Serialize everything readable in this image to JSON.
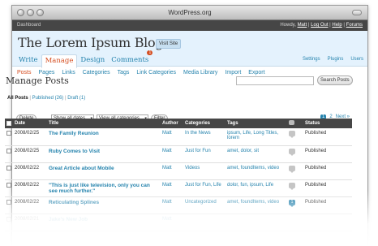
{
  "window": {
    "title": "WordPress.org"
  },
  "admin_bar": {
    "left": "Dashboard",
    "howdy": "Howdy,",
    "user": "Matt",
    "links": [
      "Log Out",
      "Help",
      "Forums"
    ]
  },
  "header": {
    "blog_title": "The Lorem Ipsum Blog",
    "visit_site": "Visit Site"
  },
  "main_nav": {
    "tabs": [
      {
        "label": "Write"
      },
      {
        "label": "Manage"
      },
      {
        "label": "Design"
      },
      {
        "label": "Comments",
        "badge": "1"
      }
    ],
    "right": [
      "Settings",
      "Plugins",
      "Users"
    ]
  },
  "sub_nav": [
    "Posts",
    "Pages",
    "Links",
    "Categories",
    "Tags",
    "Link Categories",
    "Media Library",
    "Import",
    "Export"
  ],
  "page": {
    "title": "Manage Posts",
    "search_button": "Search Posts",
    "search_value": ""
  },
  "status_filter": {
    "all": "All Posts",
    "published": "Published (26)",
    "draft": "Draft (1)"
  },
  "filters": {
    "delete": "Delete",
    "dates": "Show all dates",
    "categories": "View all categories",
    "filter": "Filter",
    "pages": [
      "1",
      "2"
    ],
    "next": "Next »"
  },
  "table": {
    "headers": {
      "date": "Date",
      "title": "Title",
      "author": "Author",
      "categories": "Categories",
      "tags": "Tags",
      "status": "Status"
    },
    "rows": [
      {
        "date": "2008/02/25",
        "title": "The Family Reunion",
        "author": "Matt",
        "categories": "In the News",
        "tags": "ipsum, Life, Long Titles, lorem",
        "comments": "",
        "status": "Published"
      },
      {
        "date": "2008/02/25",
        "title": "Ruby Comes to Visit",
        "author": "Matt",
        "categories": "Just for Fun",
        "tags": "amet, dolor, sit",
        "comments": "",
        "status": "Published"
      },
      {
        "date": "2008/02/22",
        "title": "Great Article about Mobile",
        "author": "Matt",
        "categories": "Videos",
        "tags": "amet, foundItems, video",
        "comments": "",
        "status": "Published"
      },
      {
        "date": "2008/02/22",
        "title": "\"This is just like television, only you can see much further.\"",
        "author": "Matt",
        "categories": "Just for Fun, Life",
        "tags": "dolor, fun, ipsum, Life",
        "comments": "",
        "status": "Published"
      },
      {
        "date": "2008/02/22",
        "title": "Reticulating Splines",
        "author": "Matt",
        "categories": "Uncategorized",
        "tags": "amet, foundItems, video",
        "comments": "1",
        "status": "Published"
      },
      {
        "date": "2008/02/21",
        "title": "Jake's New Job",
        "author": "Matt",
        "categories": "",
        "tags": "",
        "comments": "",
        "status": ""
      }
    ]
  }
}
